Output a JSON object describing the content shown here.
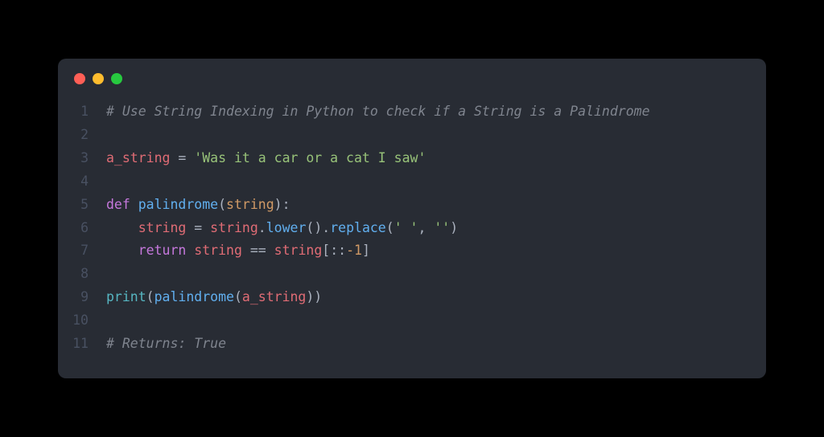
{
  "lines": [
    {
      "n": "1",
      "tokens": [
        {
          "cls": "tok-comment",
          "t": "# Use String Indexing in Python to check if a String is a Palindrome"
        }
      ]
    },
    {
      "n": "2",
      "tokens": []
    },
    {
      "n": "3",
      "tokens": [
        {
          "cls": "tok-ident",
          "t": "a_string"
        },
        {
          "cls": "tok-white",
          "t": " "
        },
        {
          "cls": "tok-op",
          "t": "="
        },
        {
          "cls": "tok-white",
          "t": " "
        },
        {
          "cls": "tok-string",
          "t": "'Was it a car or a cat I saw'"
        }
      ]
    },
    {
      "n": "4",
      "tokens": []
    },
    {
      "n": "5",
      "tokens": [
        {
          "cls": "tok-keyword",
          "t": "def"
        },
        {
          "cls": "tok-white",
          "t": " "
        },
        {
          "cls": "tok-funcdef",
          "t": "palindrome"
        },
        {
          "cls": "tok-punct",
          "t": "("
        },
        {
          "cls": "tok-param",
          "t": "string"
        },
        {
          "cls": "tok-punct",
          "t": "):"
        }
      ]
    },
    {
      "n": "6",
      "tokens": [
        {
          "cls": "tok-white",
          "t": "    "
        },
        {
          "cls": "tok-ident",
          "t": "string"
        },
        {
          "cls": "tok-white",
          "t": " "
        },
        {
          "cls": "tok-op",
          "t": "="
        },
        {
          "cls": "tok-white",
          "t": " "
        },
        {
          "cls": "tok-ident",
          "t": "string"
        },
        {
          "cls": "tok-punct",
          "t": "."
        },
        {
          "cls": "tok-call",
          "t": "lower"
        },
        {
          "cls": "tok-punct",
          "t": "()."
        },
        {
          "cls": "tok-call",
          "t": "replace"
        },
        {
          "cls": "tok-punct",
          "t": "("
        },
        {
          "cls": "tok-string",
          "t": "' '"
        },
        {
          "cls": "tok-punct",
          "t": ", "
        },
        {
          "cls": "tok-string",
          "t": "''"
        },
        {
          "cls": "tok-punct",
          "t": ")"
        }
      ]
    },
    {
      "n": "7",
      "tokens": [
        {
          "cls": "tok-white",
          "t": "    "
        },
        {
          "cls": "tok-keyword",
          "t": "return"
        },
        {
          "cls": "tok-white",
          "t": " "
        },
        {
          "cls": "tok-ident",
          "t": "string"
        },
        {
          "cls": "tok-white",
          "t": " "
        },
        {
          "cls": "tok-op",
          "t": "=="
        },
        {
          "cls": "tok-white",
          "t": " "
        },
        {
          "cls": "tok-ident",
          "t": "string"
        },
        {
          "cls": "tok-punct",
          "t": "[::"
        },
        {
          "cls": "tok-number",
          "t": "-1"
        },
        {
          "cls": "tok-punct",
          "t": "]"
        }
      ]
    },
    {
      "n": "8",
      "tokens": []
    },
    {
      "n": "9",
      "tokens": [
        {
          "cls": "tok-builtin",
          "t": "print"
        },
        {
          "cls": "tok-punct",
          "t": "("
        },
        {
          "cls": "tok-call",
          "t": "palindrome"
        },
        {
          "cls": "tok-punct",
          "t": "("
        },
        {
          "cls": "tok-ident",
          "t": "a_string"
        },
        {
          "cls": "tok-punct",
          "t": "))"
        }
      ]
    },
    {
      "n": "10",
      "tokens": []
    },
    {
      "n": "11",
      "tokens": [
        {
          "cls": "tok-comment",
          "t": "# Returns: True"
        }
      ]
    }
  ]
}
